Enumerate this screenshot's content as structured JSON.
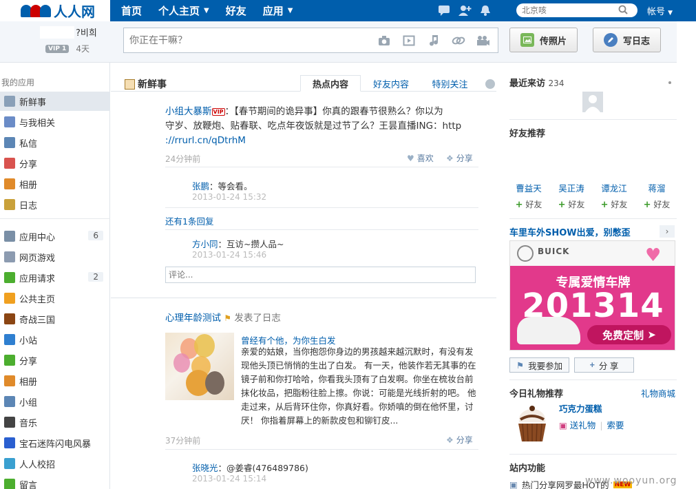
{
  "nav": {
    "logo_text": "人人网",
    "items": [
      {
        "label": "首页",
        "dropdown": false
      },
      {
        "label": "个人主页",
        "dropdown": true
      },
      {
        "label": "好友",
        "dropdown": false
      },
      {
        "label": "应用",
        "dropdown": true
      }
    ],
    "search_placeholder": "北京咳",
    "account_label": "帐号"
  },
  "user": {
    "name_tail": "?비희",
    "vip_label": "VIP 1",
    "days": "4天"
  },
  "publisher": {
    "placeholder": "你正在干嘛？",
    "upload_button": "传照片",
    "blog_button": "写日志"
  },
  "sidebar": {
    "title": "我的应用",
    "items": [
      {
        "label": "新鲜事",
        "count": "",
        "color": "#8aa0b8",
        "active": true
      },
      {
        "label": "与我相关",
        "count": "",
        "color": "#6b8cc7"
      },
      {
        "label": "私信",
        "count": "",
        "color": "#5c86b5"
      },
      {
        "label": "分享",
        "count": "",
        "color": "#d9534f"
      },
      {
        "label": "相册",
        "count": "",
        "color": "#e08a2a"
      },
      {
        "label": "日志",
        "count": "",
        "color": "#c9a13a"
      },
      {
        "label": "应用中心",
        "count": "6",
        "color": "#7a8fa6"
      },
      {
        "label": "网页游戏",
        "count": "",
        "color": "#8c9bb0"
      },
      {
        "label": "应用请求",
        "count": "2",
        "color": "#4cae2f"
      },
      {
        "label": "公共主页",
        "count": "",
        "color": "#f0a020"
      },
      {
        "label": "奇战三国",
        "count": "",
        "color": "#8b4513"
      },
      {
        "label": "小站",
        "count": "",
        "color": "#2f7fd0"
      },
      {
        "label": "分享",
        "count": "",
        "color": "#4cae2f"
      },
      {
        "label": "相册",
        "count": "",
        "color": "#e08a2a"
      },
      {
        "label": "小组",
        "count": "",
        "color": "#5c86b5"
      },
      {
        "label": "音乐",
        "count": "",
        "color": "#444444"
      },
      {
        "label": "宝石迷阵闪电风暴",
        "count": "",
        "color": "#2a5fd0"
      },
      {
        "label": "人人校招",
        "count": "",
        "color": "#3aa0d0"
      },
      {
        "label": "留言",
        "count": "",
        "color": "#4cae2f"
      }
    ]
  },
  "feed": {
    "title": "新鲜事",
    "tabs": [
      "热点内容",
      "好友内容",
      "特别关注"
    ],
    "post1": {
      "author": "小组大暴斯",
      "vip": "VIP",
      "line1": "：【春节期间的诡异事】你真的跟春节很熟么？你以为",
      "line2": "守岁、放鞭炮、贴春联、吃点年夜饭就是过节了么？王昙直播ING：http",
      "line3": "://rrurl.cn/qDtrhM",
      "time": "24分钟前",
      "like_label": "喜欢",
      "share_label": "分享",
      "comments": [
        {
          "who": "张鹏",
          "text": "：等会看。",
          "time": "2013-01-24 15:32"
        },
        {
          "who": "方小同",
          "text": "：互访~攒人品~",
          "time": "2013-01-24 15:46"
        }
      ],
      "more_replies": "还有1条回复",
      "comment_placeholder": "评论..."
    },
    "post2": {
      "author": "心理年龄测试",
      "action": "发表了日志",
      "blog_title": "曾经有个他，为你生白发",
      "blog_lines": [
        "亲爱的姑娘，当你抱怨你身边的男孩越来越沉默时，有没有发",
        "现他头顶已悄悄的生出了白发。 有一天，他装作若无其事的在",
        "镜子前和你打哈哈，你看我头顶有了白发啊。你坐在梳妆台前",
        "抹化妆品，把脂粉往脸上擦。你说：可能是光线折射的吧。 他",
        "走过来，从后背环住你，你真好看。你娇嗔的倒在他怀里，讨",
        "厌！ 你指着屏幕上的新款皮包和铆钉皮..."
      ],
      "time": "37分钟前",
      "share_label": "分享",
      "comment": {
        "who": "张晓光",
        "text": "：@姜睿(476489786)",
        "time": "2013-01-24 15:14"
      }
    }
  },
  "right": {
    "visitors_title": "最近来访",
    "visitors_count": "234",
    "friend_rec_title": "好友推荐",
    "friends": [
      {
        "name": "曹益天",
        "add": "好友"
      },
      {
        "name": "吴正涛",
        "add": "好友"
      },
      {
        "name": "谭龙江",
        "add": "好友"
      },
      {
        "name": "蒋溜",
        "add": "好友"
      }
    ],
    "ad_title": "车里车外SHOW出爱，别憋歪",
    "ad_brand": "BUICK",
    "ad_line1": "专属爱情车牌",
    "ad_line2": "201314",
    "ad_cta": "免费定制",
    "join_button": "我要参加",
    "share_button": "分 享",
    "gift_title": "今日礼物推荐",
    "gift_shop": "礼物商城",
    "gift_name": "巧克力蛋糕",
    "gift_send": "送礼物",
    "gift_ask": "索要",
    "func_title": "站内功能",
    "func_item": "热门分享网罗最HOT的",
    "func_new": "NEW"
  },
  "watermark": "www.wooyun.org"
}
